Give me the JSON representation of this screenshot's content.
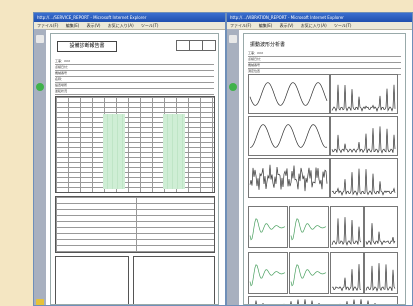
{
  "windows": [
    {
      "title": "http://.../SERVICE_REPORT - Microsoft Internet Explorer",
      "menu": [
        "ファイル(F)",
        "編集(E)",
        "表示(V)",
        "お気に入り(A)",
        "ツール(T)",
        "ヘルプ(H)"
      ],
      "document": {
        "title": "設備診断報告書",
        "fields": [
          "工事：XXX",
          "点検日付：",
          "機械番号",
          "名称：",
          "設置場所",
          "運転状況"
        ]
      }
    },
    {
      "title": "http://.../VIBRATION_REPORT - Microsoft Internet Explorer",
      "menu": [
        "ファイル(F)",
        "編集(E)",
        "表示(V)",
        "お気に入り(A)",
        "ツール(T)",
        "ヘルプ(H)"
      ],
      "document": {
        "title": "振動波形分析書",
        "fields": [
          "工事：XXX",
          "点検日付：",
          "機械番号",
          "測定位置"
        ]
      }
    }
  ],
  "colors": {
    "background": "#f4e6c2",
    "titlebar": "#2a5fc4",
    "grid_fill": "#cfeed5",
    "chart_line": "#333333"
  }
}
